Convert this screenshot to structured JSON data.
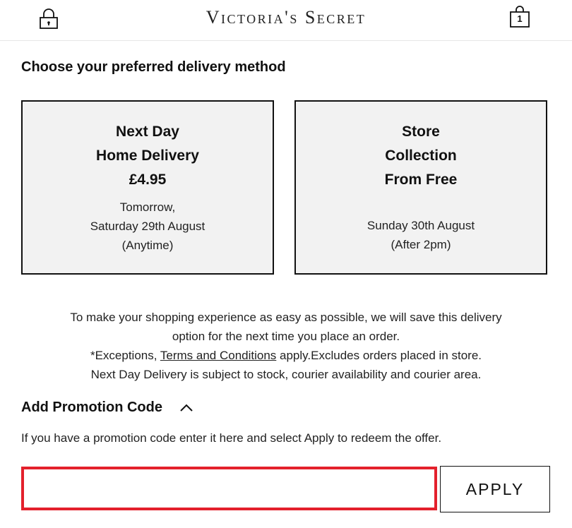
{
  "header": {
    "logo": "Victoria's Secret",
    "bag_count": "1",
    "lock_icon": "lock-icon",
    "bag_icon": "shopping-bag-icon"
  },
  "delivery": {
    "title": "Choose your preferred delivery method",
    "options": [
      {
        "line1": "Next Day",
        "line2": "Home Delivery",
        "line3": "£4.95",
        "detail": [
          "Tomorrow,",
          "Saturday 29th August",
          "(Anytime)"
        ]
      },
      {
        "line1": "Store",
        "line2": "Collection",
        "line3": "From Free",
        "detail": [
          "Sunday 30th August",
          "(After 2pm)"
        ]
      }
    ]
  },
  "info": {
    "line1": "To make your shopping experience as easy as possible, we will save this delivery",
    "line2": "option for the next time you place an order.",
    "line3_prefix": "*Exceptions, ",
    "terms_link": "Terms and Conditions",
    "line3_suffix": " apply.Excludes orders placed in store.",
    "line4": "Next Day Delivery is subject to stock, courier availability and courier area."
  },
  "promo": {
    "title": "Add Promotion Code",
    "toggle_icon": "chevron-up-icon",
    "description": "If you have a promotion code enter it here and select Apply to redeem the offer.",
    "input_value": "",
    "apply_label": "APPLY",
    "input_border_color": "#e3202c"
  }
}
